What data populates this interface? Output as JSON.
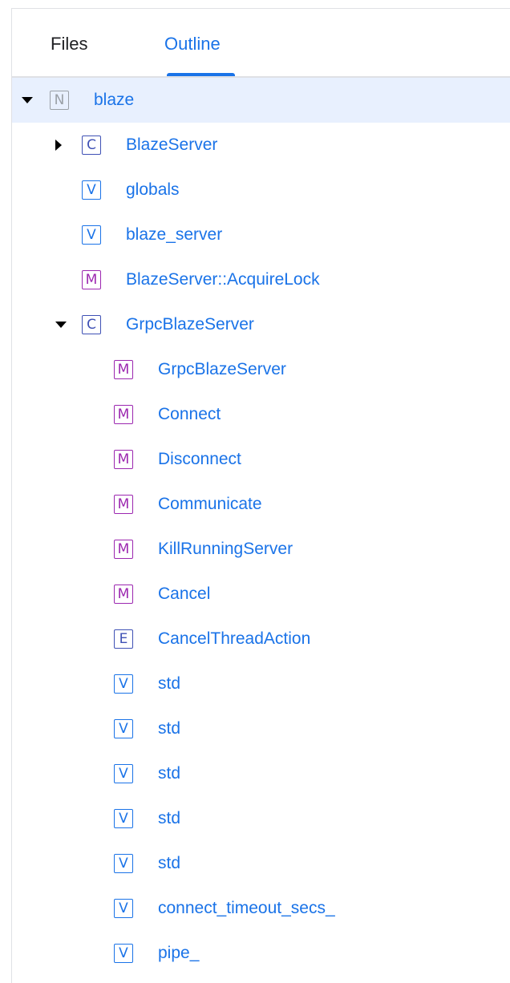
{
  "tabs": [
    {
      "label": "Files",
      "active": false
    },
    {
      "label": "Outline",
      "active": true
    }
  ],
  "colors": {
    "accent": "#1a73e8",
    "selected_row_bg": "#e8f0fe",
    "kind_N": "#9aa0a6",
    "kind_C": "#3f51b5",
    "kind_E": "#3f51b5",
    "kind_V": "#1a73e8",
    "kind_M": "#9c27b0"
  },
  "outline": [
    {
      "depth": 0,
      "caret": "down",
      "kind": "N",
      "label": "blaze",
      "selected": true
    },
    {
      "depth": 1,
      "caret": "right",
      "kind": "C",
      "label": "BlazeServer"
    },
    {
      "depth": 1,
      "caret": "none",
      "kind": "V",
      "label": "globals"
    },
    {
      "depth": 1,
      "caret": "none",
      "kind": "V",
      "label": "blaze_server"
    },
    {
      "depth": 1,
      "caret": "none",
      "kind": "M",
      "label": "BlazeServer::AcquireLock"
    },
    {
      "depth": 1,
      "caret": "down",
      "kind": "C",
      "label": "GrpcBlazeServer"
    },
    {
      "depth": 2,
      "caret": "none",
      "kind": "M",
      "label": "GrpcBlazeServer"
    },
    {
      "depth": 2,
      "caret": "none",
      "kind": "M",
      "label": "Connect"
    },
    {
      "depth": 2,
      "caret": "none",
      "kind": "M",
      "label": "Disconnect"
    },
    {
      "depth": 2,
      "caret": "none",
      "kind": "M",
      "label": "Communicate"
    },
    {
      "depth": 2,
      "caret": "none",
      "kind": "M",
      "label": "KillRunningServer"
    },
    {
      "depth": 2,
      "caret": "none",
      "kind": "M",
      "label": "Cancel"
    },
    {
      "depth": 2,
      "caret": "none",
      "kind": "E",
      "label": "CancelThreadAction"
    },
    {
      "depth": 2,
      "caret": "none",
      "kind": "V",
      "label": "std"
    },
    {
      "depth": 2,
      "caret": "none",
      "kind": "V",
      "label": "std"
    },
    {
      "depth": 2,
      "caret": "none",
      "kind": "V",
      "label": "std"
    },
    {
      "depth": 2,
      "caret": "none",
      "kind": "V",
      "label": "std"
    },
    {
      "depth": 2,
      "caret": "none",
      "kind": "V",
      "label": "std"
    },
    {
      "depth": 2,
      "caret": "none",
      "kind": "V",
      "label": "connect_timeout_secs_"
    },
    {
      "depth": 2,
      "caret": "none",
      "kind": "V",
      "label": "pipe_"
    }
  ]
}
